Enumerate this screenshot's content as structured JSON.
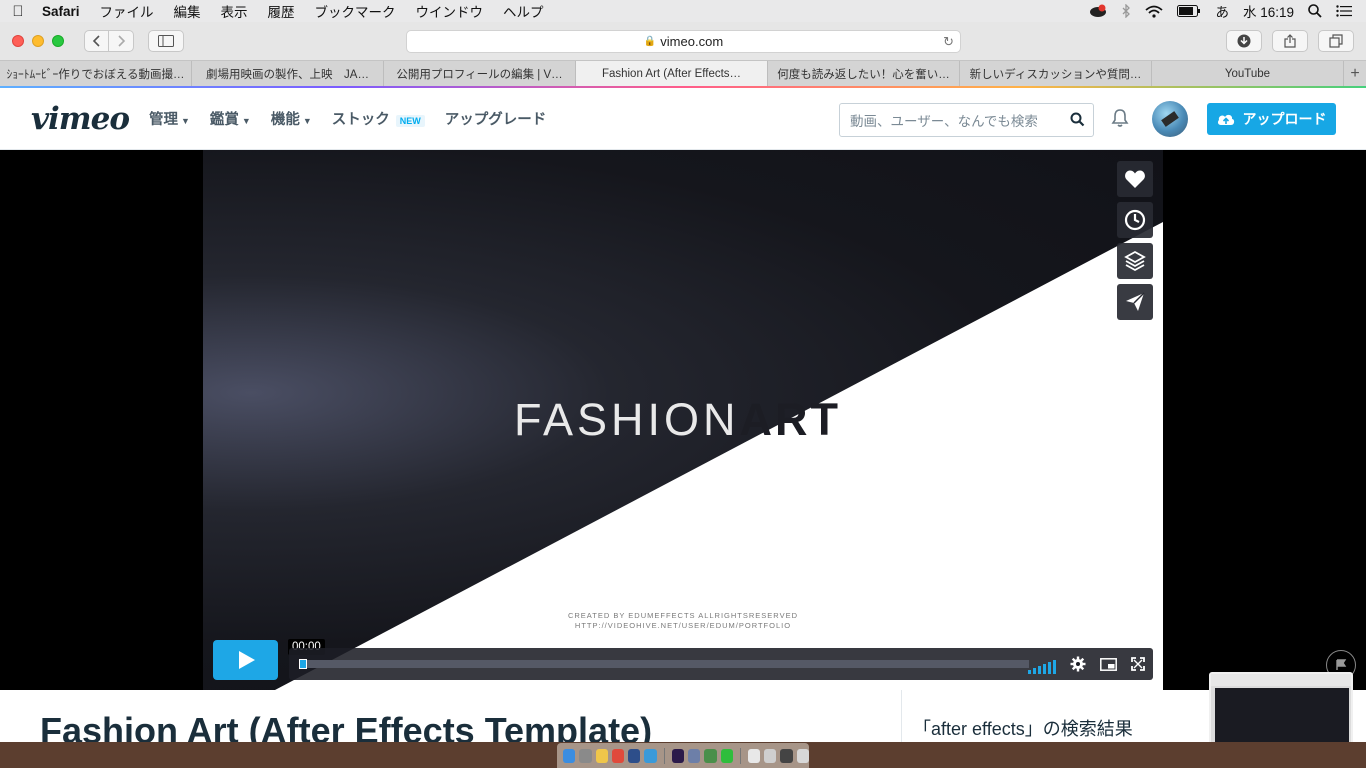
{
  "menubar": {
    "app": "Safari",
    "items": [
      "ファイル",
      "編集",
      "表示",
      "履歴",
      "ブックマーク",
      "ウインドウ",
      "ヘルプ"
    ],
    "input_method": "あ",
    "clock": "水 16:19"
  },
  "browser": {
    "url": "vimeo.com",
    "tabs": [
      {
        "label": "ｼｮｰﾄﾑｰﾋﾞｰ作りでおぼえる動画撮…",
        "active": false
      },
      {
        "label": "劇場用映画の製作、上映　JA…",
        "active": false
      },
      {
        "label": "公開用プロフィールの編集 | V…",
        "active": false
      },
      {
        "label": "Fashion Art (After Effects…",
        "active": true
      },
      {
        "label": "何度も読み返したい！心を奮い…",
        "active": false
      },
      {
        "label": "新しいディスカッションや質問…",
        "active": false
      },
      {
        "label": "YouTube",
        "active": false
      }
    ],
    "new_tab": "+"
  },
  "vimeo": {
    "logo": "vimeo",
    "nav": {
      "manage": "管理",
      "watch": "鑑賞",
      "features": "機能",
      "stock": "ストック",
      "stock_badge": "NEW",
      "upgrade": "アップグレード"
    },
    "search_placeholder": "動画、ユーザー、なんでも検索",
    "upload": "アップロード"
  },
  "player": {
    "title_light": "FASHION",
    "title_bold": "ART",
    "credit_line1": "CREATED BY EDUMEFFECTS ALLRIGHTSRESERVED",
    "credit_line2": "HTTP://VIDEOHIVE.NET/USER/EDUM/PORTFOLIO",
    "time": "00:00",
    "progress": 0,
    "side_actions": [
      "heart-icon",
      "clock-icon",
      "layers-icon",
      "send-icon"
    ]
  },
  "page": {
    "video_title": "Fashion Art (After Effects Template)",
    "related_title": "「after effects」の検索結果"
  },
  "colors": {
    "vimeo_blue": "#17a7e5",
    "vimeo_dark": "#1a2e3b"
  }
}
